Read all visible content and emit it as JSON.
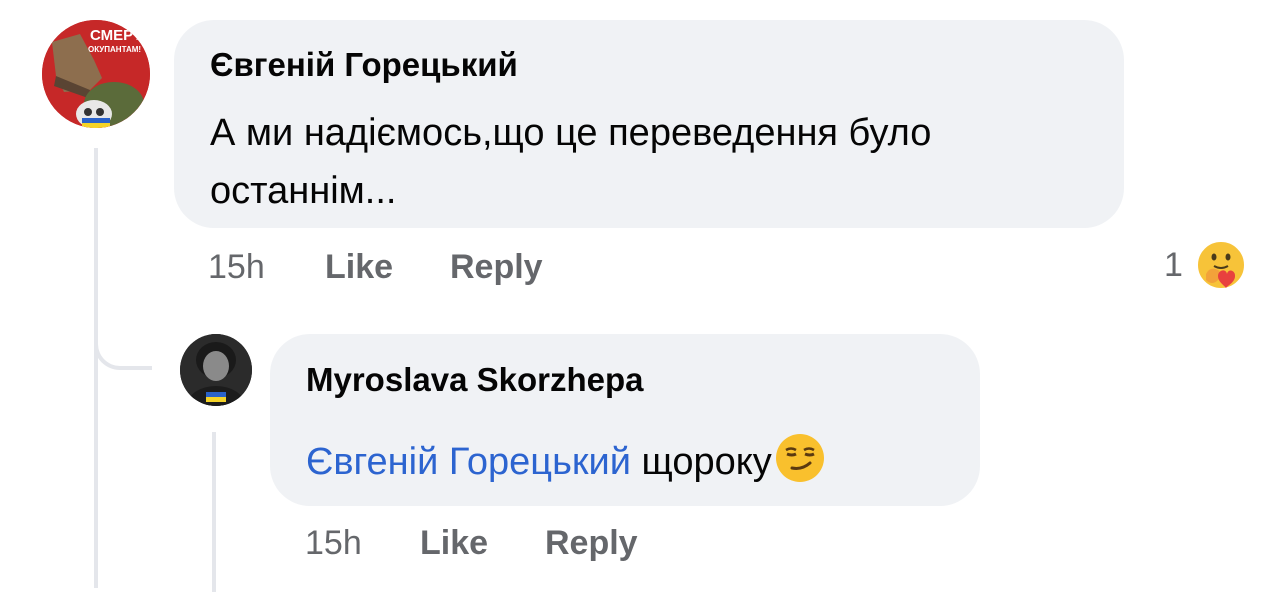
{
  "comment": {
    "author": "Євгеній Горецький",
    "text": "А ми надіємось,що це переведення було останнім...",
    "avatar_icon": "soldier-boot-avatar",
    "avatar_text_top": "СМЕРТЬ",
    "avatar_text_bottom": "ОКУПАНТАМ!",
    "time": "15h",
    "like_label": "Like",
    "reply_label": "Reply",
    "reaction_count": "1",
    "reaction_icon": "care-emoji-icon"
  },
  "reply": {
    "author": "Myroslava Skorzhepa",
    "mention": "Євгеній Горецький",
    "text": " щороку",
    "emoji_icon": "smirking-face-emoji",
    "avatar_icon": "profile-photo-avatar",
    "time": "15h",
    "like_label": "Like",
    "reply_label": "Reply"
  },
  "colors": {
    "bubble": "#f0f2f5",
    "mention": "#2c64d0",
    "meta": "#65676b",
    "thread_line": "#e4e6eb"
  }
}
